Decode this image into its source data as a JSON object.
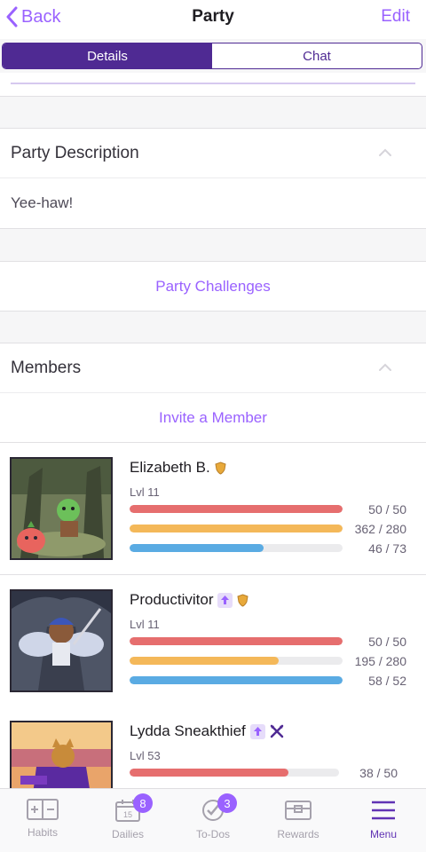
{
  "nav": {
    "back_label": "Back",
    "title": "Party",
    "edit_label": "Edit"
  },
  "segments": {
    "details": "Details",
    "chat": "Chat",
    "selected": "Details"
  },
  "description": {
    "header": "Party Description",
    "text": "Yee-haw!"
  },
  "challenges": {
    "label": "Party Challenges"
  },
  "members_section": {
    "header": "Members",
    "invite_label": "Invite a Member"
  },
  "members": [
    {
      "name": "Elizabeth B.",
      "level": "Lvl 11",
      "hp": "50 / 50",
      "hp_fraction": 1.0,
      "exp": "362 / 280",
      "exp_fraction": 1.0,
      "mp": "46 / 73",
      "mp_fraction": 0.63,
      "icons": [
        "shield-icon"
      ]
    },
    {
      "name": "Productivitor",
      "level": "Lvl 11",
      "hp": "50 / 50",
      "hp_fraction": 1.0,
      "exp": "195 / 280",
      "exp_fraction": 0.7,
      "mp": "58 / 52",
      "mp_fraction": 1.0,
      "icons": [
        "arrow-up-icon",
        "shield-icon"
      ]
    },
    {
      "name": "Lydda Sneakthief",
      "level": "Lvl 53",
      "hp": "38 / 50",
      "hp_fraction": 0.76,
      "exp": "",
      "mp": "",
      "icons": [
        "arrow-up-icon",
        "crossed-swords-icon"
      ]
    }
  ],
  "tabs": [
    {
      "label": "Habits",
      "icon": "habits-icon"
    },
    {
      "label": "Dailies",
      "icon": "calendar-icon",
      "badge": "8"
    },
    {
      "label": "To-Dos",
      "icon": "checkmark-icon",
      "badge": "3"
    },
    {
      "label": "Rewards",
      "icon": "treasure-chest-icon"
    },
    {
      "label": "Menu",
      "icon": "menu-icon",
      "active": true
    }
  ],
  "colors": {
    "accent": "#9a62ff",
    "brand_dark": "#4f2a93",
    "health": "#e66e6e",
    "experience": "#f4b859",
    "mana": "#5aabe3"
  }
}
